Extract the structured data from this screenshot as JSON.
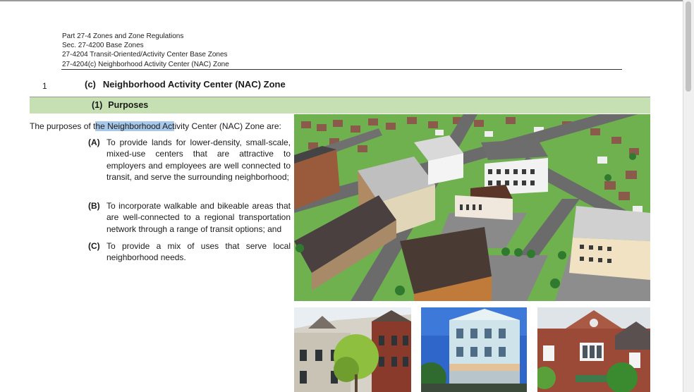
{
  "header": {
    "lines": [
      "Part 27-4 Zones and Zone Regulations",
      "Sec. 27-4200 Base Zones",
      "27-4204 Transit-Oriented/Activity Center Base Zones",
      "27-4204(c) Neighborhood Activity Center (NAC) Zone"
    ]
  },
  "line_number": "1",
  "section": {
    "label": "(c)",
    "title": "Neighborhood Activity Center (NAC) Zone"
  },
  "purposes": {
    "label": "(1)",
    "title": "Purposes"
  },
  "intro": {
    "before": "The purposes of t",
    "highlight": "he Neighborhood Act",
    "after": "ivity Center (NAC) Zone are:"
  },
  "items": [
    {
      "label": "(A)",
      "text": "To provide lands for lower-density, small-scale, mixed-use centers that are attractive to employers and employees are well connected to transit, and serve the surrounding neighborhood;"
    },
    {
      "label": "(B)",
      "text": "To incorporate walkable and bikeable areas that are well-connected to a regional transportation network through a range of transit options; and"
    },
    {
      "label": "(C)",
      "text": "To provide a mix of uses that serve local neighborhood needs."
    }
  ],
  "colors": {
    "purpose_bar": "#c6e0b4",
    "highlight": "#a8c8ea",
    "grass": "#6fb14f",
    "road": "#6b6b6b"
  }
}
